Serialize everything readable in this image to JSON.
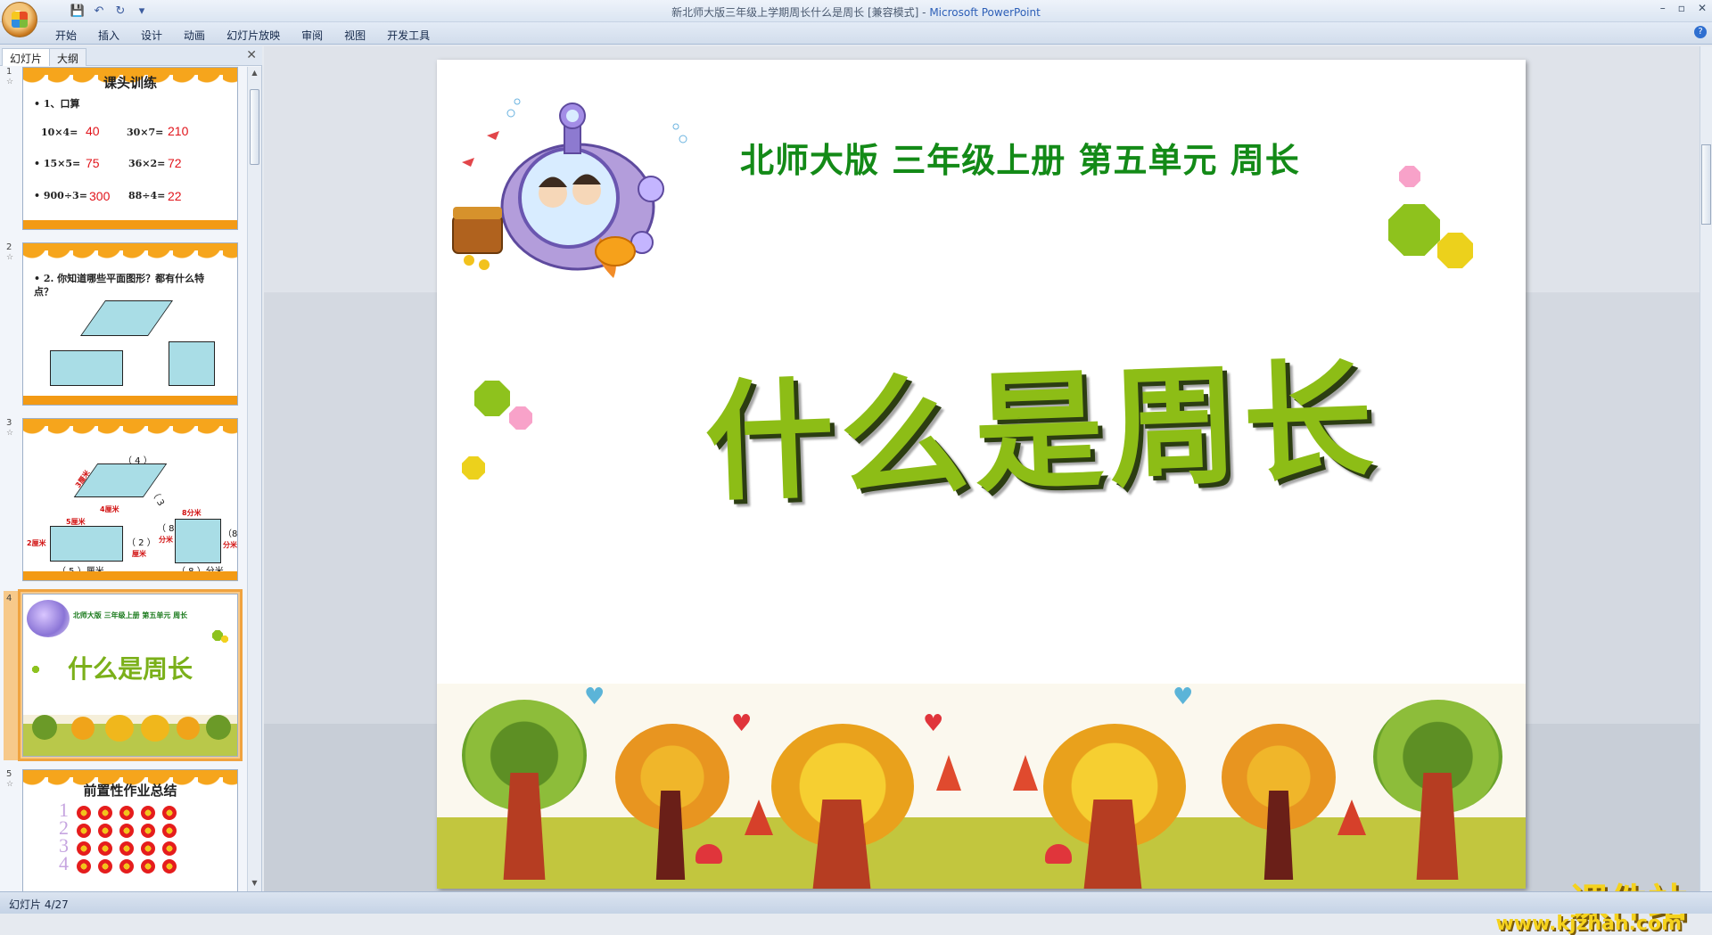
{
  "window": {
    "title": "新北师大版三年级上学期周长什么是周长 [兼容模式]",
    "app_name": "Microsoft PowerPoint",
    "controls": [
      "–",
      "▫",
      "✕"
    ]
  },
  "quick_access": [
    "save-icon",
    "undo-icon",
    "redo-icon",
    "customize-icon"
  ],
  "ribbon": {
    "tabs": [
      "开始",
      "插入",
      "设计",
      "动画",
      "幻灯片放映",
      "审阅",
      "视图",
      "开发工具"
    ]
  },
  "left_panel": {
    "tabs": [
      "幻灯片",
      "大纲"
    ],
    "close": "✕",
    "thumbnails": [
      {
        "num": "1",
        "title": "课头训练",
        "item_label": "• 1、口算",
        "rows": [
          [
            "10×4=",
            "40",
            "30×7=",
            "210"
          ],
          [
            "• 15×5=",
            "75",
            "36×2=",
            "72"
          ],
          [
            "• 900÷3=",
            "300",
            "88÷4=",
            "22"
          ]
        ]
      },
      {
        "num": "2",
        "question": "• 2. 你知道哪些平面图形？都有什么特点？"
      },
      {
        "num": "3",
        "labels": [
          "（ 4 ）",
          "3厘米",
          "4厘米",
          "（ 3",
          "5厘米",
          "2厘米",
          "（ 2 ）",
          "厘米",
          "（ 5 ）厘米",
          "（ 8",
          "8分米",
          "分米",
          "（ 8 ）分米",
          "（8",
          "分米"
        ]
      },
      {
        "num": "4",
        "subtitle": "北师大版  三年级上册  第五单元  周长",
        "main_title": "什么是周长",
        "selected": true
      },
      {
        "num": "5",
        "title": "前置性作业总结",
        "digits": [
          "1",
          "2",
          "3",
          "4"
        ]
      }
    ]
  },
  "slide": {
    "subtitle": "北师大版  三年级上册  第五单元  周长",
    "title": "什么是周长"
  },
  "watermark": {
    "text": "课件站",
    "url": "www.kjzhan.com"
  },
  "status": {
    "slide_indicator": "幻灯片 4/27"
  }
}
